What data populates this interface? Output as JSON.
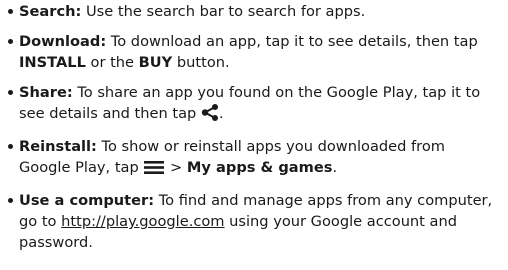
{
  "items": [
    {
      "term": "Search:",
      "text": " Use the search bar to search for apps."
    },
    {
      "term": "Download:",
      "text_a": " To download an app, tap it to see details, then tap ",
      "kw1": "INSTALL",
      "text_b": " or the ",
      "kw2": "BUY",
      "text_c": " button."
    },
    {
      "term": "Share:",
      "text_a": " To share an app you found on the Google Play, tap it to see details and then tap ",
      "icon": "share-icon",
      "text_b": "."
    },
    {
      "term": "Reinstall:",
      "text_a": " To show or reinstall apps you downloaded from Google Play, tap ",
      "icon": "menu-icon",
      "sep": " > ",
      "kw": "My apps & games",
      "text_b": "."
    },
    {
      "term": "Use a computer:",
      "text_a": " To find and manage apps from any computer, go to ",
      "link": "http://play.google.com",
      "text_b": " using your Google account and password."
    }
  ]
}
